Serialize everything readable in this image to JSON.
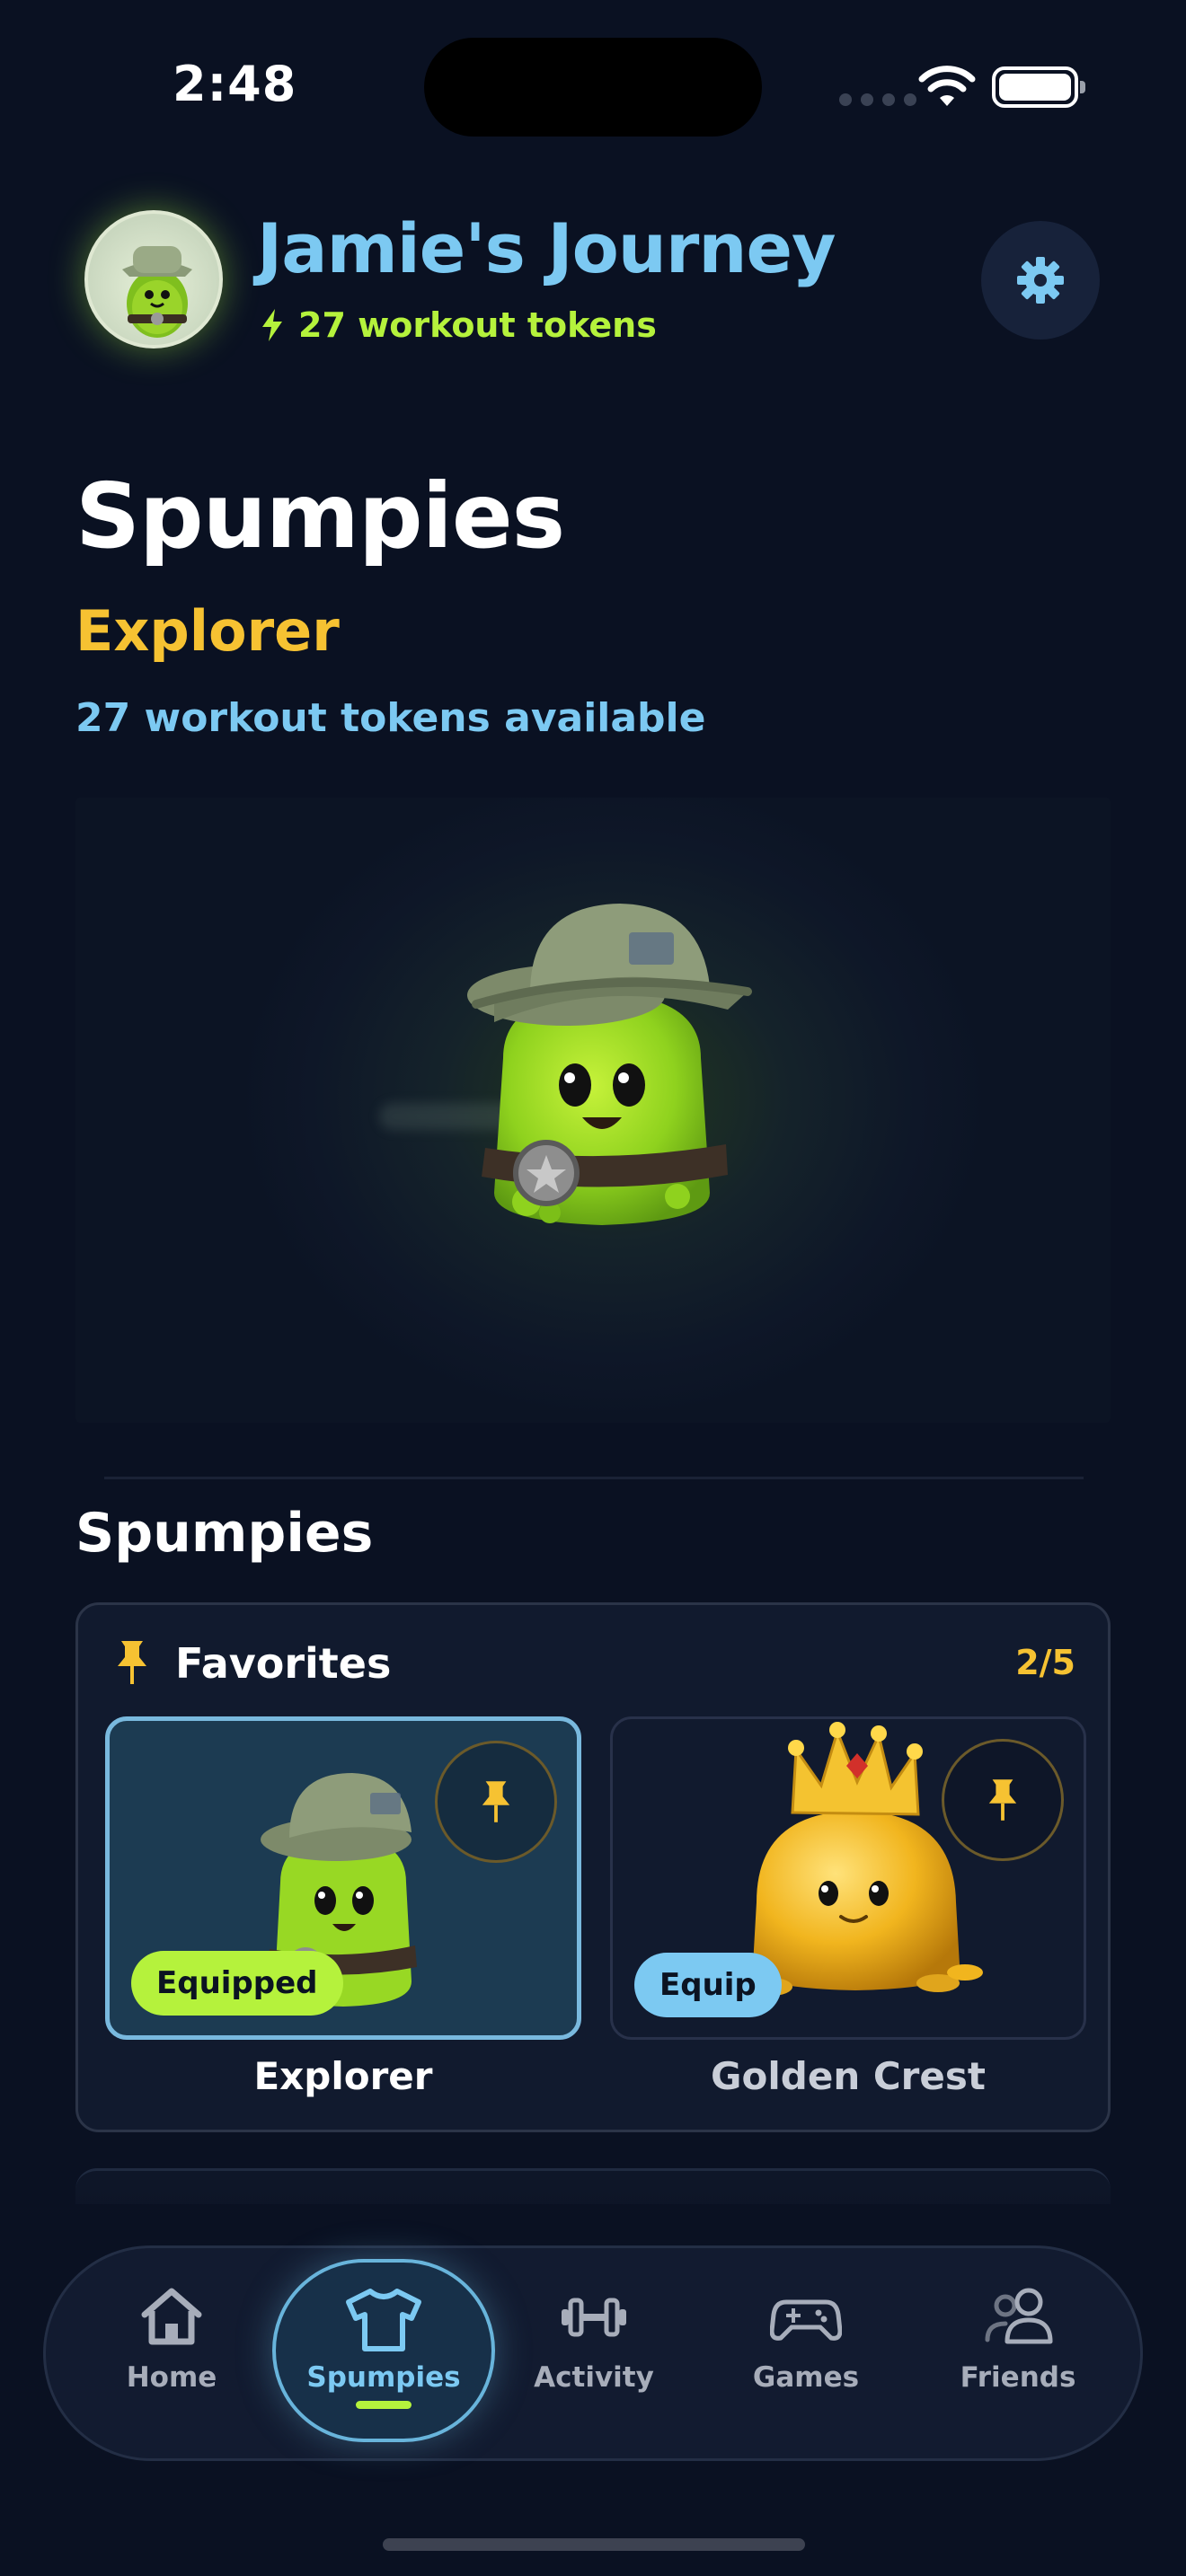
{
  "status_bar": {
    "time": "2:48"
  },
  "header": {
    "title": "Jamie's Journey",
    "tokens_text": "27 workout tokens"
  },
  "main": {
    "page_title": "Spumpies",
    "rank_title": "Explorer",
    "tokens_available": "27 workout tokens available",
    "section_title": "Spumpies"
  },
  "favorites": {
    "label": "Favorites",
    "count": "2/5",
    "items": [
      {
        "name": "Explorer",
        "badge": "Equipped"
      },
      {
        "name": "Golden Crest",
        "badge": "Equip"
      }
    ]
  },
  "nav": {
    "items": [
      {
        "label": "Home",
        "icon": "home-icon"
      },
      {
        "label": "Spumpies",
        "icon": "tshirt-icon"
      },
      {
        "label": "Activity",
        "icon": "dumbbell-icon"
      },
      {
        "label": "Games",
        "icon": "gamepad-icon"
      },
      {
        "label": "Friends",
        "icon": "friends-icon"
      }
    ],
    "active": "Spumpies"
  },
  "colors": {
    "background": "#0a1122",
    "accent_blue": "#7cc9f2",
    "accent_lime": "#b5f23c",
    "accent_gold": "#f6c232"
  }
}
